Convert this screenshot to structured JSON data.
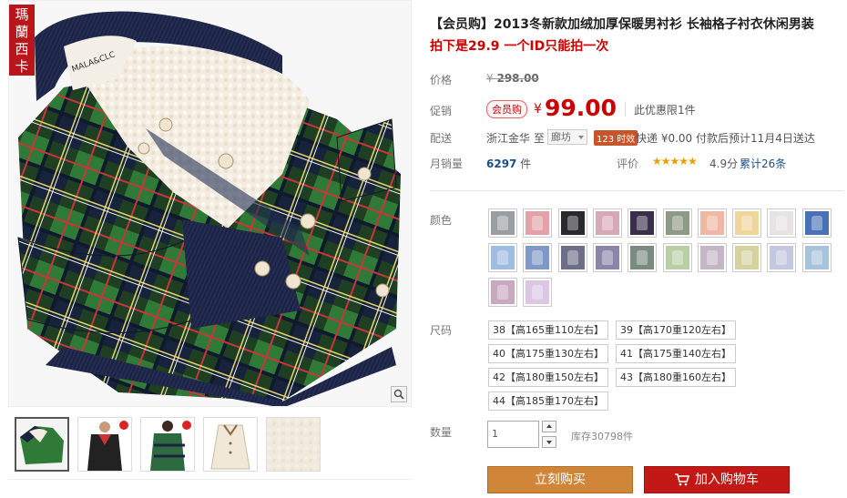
{
  "gallery": {
    "brand_stamp": "瑪蘭西卡",
    "collar_label": "MALA&CLC",
    "thumbnails": [
      "thumb-1",
      "thumb-2",
      "thumb-3",
      "thumb-4",
      "thumb-5"
    ]
  },
  "product": {
    "title": "【会员购】2013冬新款加绒加厚保暖男衬衫 长袖格子衬衣休闲男装",
    "subtitle": "拍下是29.9 一个ID只能拍一次"
  },
  "price": {
    "label": "价格",
    "currency": "¥",
    "original": "298.00"
  },
  "promo": {
    "label": "促销",
    "tag": "会员购",
    "currency": "¥",
    "price": "99.00",
    "limit": "此优惠限1件"
  },
  "shipping": {
    "label": "配送",
    "from": "浙江金华",
    "to_label": "至",
    "to_value": "廊坊",
    "badge": "123 时效",
    "detail": "快递 ¥0.00 付款后预计11月4日送达"
  },
  "sales": {
    "label": "月销量",
    "count": "6297",
    "unit": "件",
    "rating_label": "评价",
    "stars": "★★★★★",
    "score": "4.9分",
    "review_count": "累计26条"
  },
  "color": {
    "label": "颜色",
    "swatches": [
      "#9a9ea3",
      "#e3a2a8",
      "#2a2a2e",
      "#d7a8b8",
      "#3a2f4a",
      "#8d9a86",
      "#f0b7a2",
      "#efd69a",
      "#e5e3e3",
      "#4a70b5",
      "#9fbce3",
      "#7f98c8",
      "#6e6f86",
      "#8b86a8",
      "#7a8b7f",
      "#b9d0a6",
      "#c5b6c6",
      "#d6d2a0",
      "#c3c7df",
      "#a8c3dc",
      "#c9a8c0",
      "#dcc6e4"
    ]
  },
  "size": {
    "label": "尺码",
    "options": [
      "38【高165重110左右】",
      "39【高170重120左右】",
      "40【高175重130左右】",
      "41【高175重140左右】",
      "42【高180重150左右】",
      "43【高180重160左右】",
      "44【高185重170左右】"
    ]
  },
  "quantity": {
    "label": "数量",
    "value": "1",
    "stock": "库存30798件"
  },
  "actions": {
    "buy_now": "立刻购买",
    "add_to_cart": "加入购物车"
  }
}
